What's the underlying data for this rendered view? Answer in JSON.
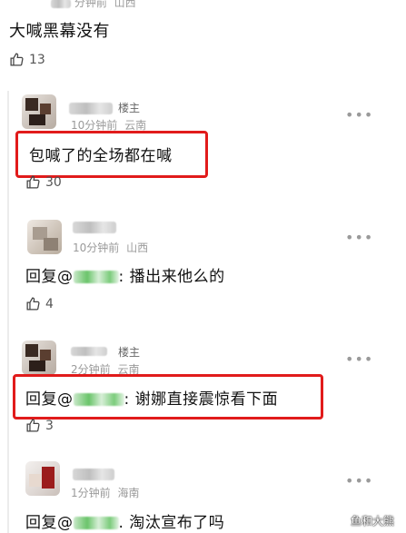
{
  "top_comment": {
    "meta_time": "分钟前",
    "meta_location": "山西",
    "text": "大喊黑幕没有",
    "likes": "13"
  },
  "replies": [
    {
      "host_badge": "楼主",
      "time": "10分钟前",
      "location": "云南",
      "text": "包喊了的全场都在喊",
      "likes": "30",
      "highlighted": true
    },
    {
      "host_badge": "",
      "time": "10分钟前",
      "location": "山西",
      "reply_prefix": "回复@",
      "text": ":  播出来他么的",
      "likes": "4",
      "highlighted": false
    },
    {
      "host_badge": "楼主",
      "time": "2分钟前",
      "location": "云南",
      "reply_prefix": "回复@",
      "text": ":  谢娜直接震惊看下面",
      "likes": "3",
      "highlighted": true
    },
    {
      "host_badge": "",
      "time": "1分钟前",
      "location": "海南",
      "reply_prefix": "回复@",
      "text": ".  淘汰宣布了吗",
      "likes": "",
      "highlighted": false
    }
  ],
  "more_label": "•••",
  "watermark": "鱼和大熊",
  "colors": {
    "highlight_box": "#e11b1b",
    "mention_blur": "#6ac46a"
  },
  "icons": {
    "like": "thumbs-up-icon",
    "more": "more-dots-icon"
  }
}
